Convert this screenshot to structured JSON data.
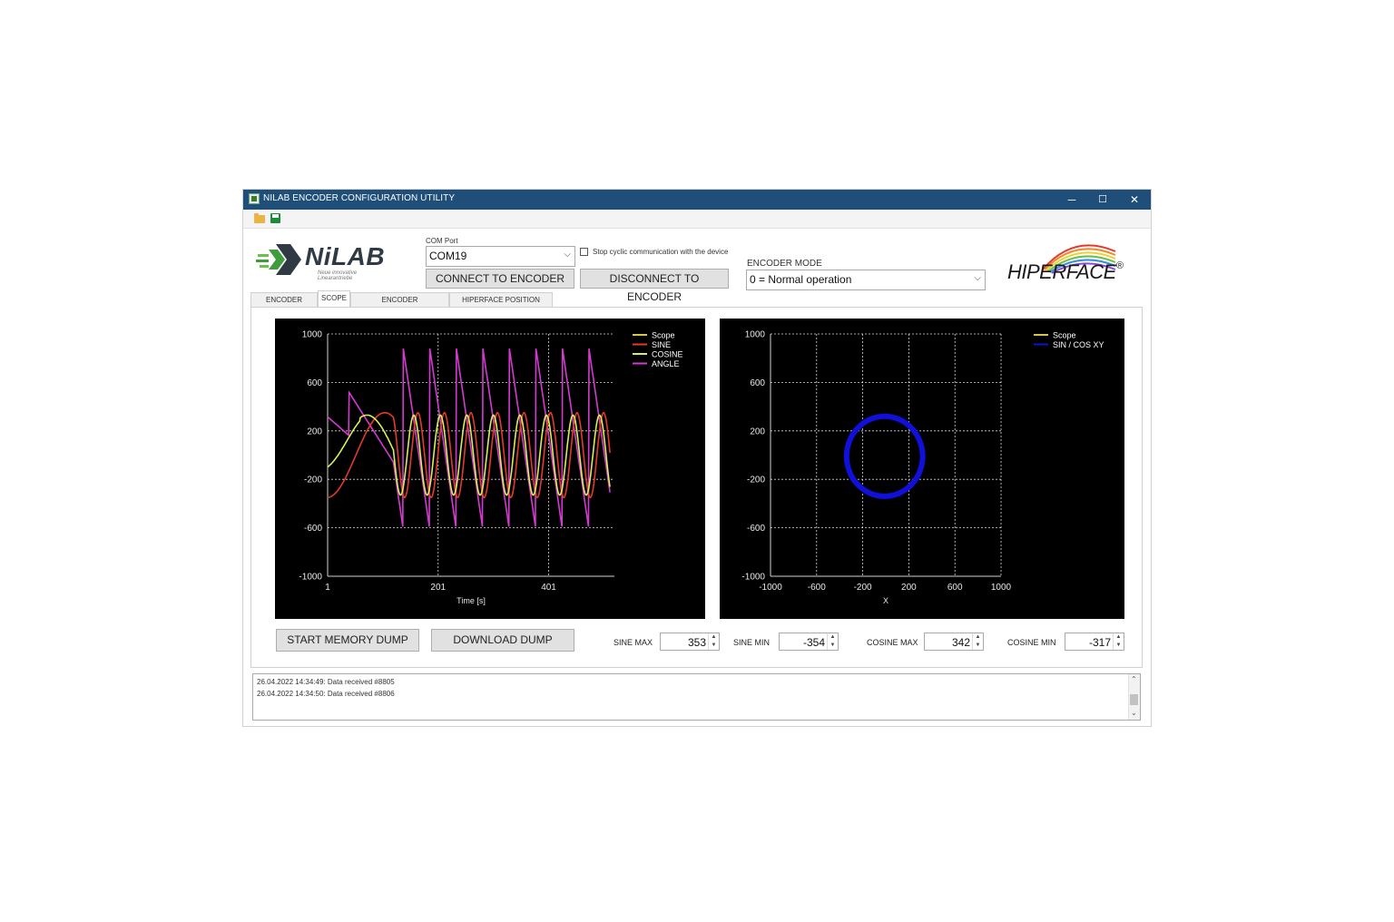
{
  "window": {
    "title": "NILAB ENCODER CONFIGURATION UTILITY",
    "minimize": "─",
    "maximize": "☐",
    "close": "✕"
  },
  "logo": {
    "brand": "NiLAB",
    "tagline": "Neue innovative Linearantriebe"
  },
  "com": {
    "label": "COM Port",
    "value": "COM19",
    "stop_label": "Stop cyclic communication with the device"
  },
  "buttons": {
    "connect": "CONNECT TO ENCODER",
    "disconnect": "DISCONNECT TO ENCODER",
    "start_dump": "START MEMORY DUMP",
    "download_dump": "DOWNLOAD DUMP"
  },
  "encoder_mode": {
    "label": "ENCODER MODE",
    "value": "0 = Normal operation"
  },
  "hiperface": {
    "text": "HIPERFACE",
    "mark": "®"
  },
  "tabs": [
    {
      "label": "ENCODER STATUS"
    },
    {
      "label": "SCOPE"
    },
    {
      "label": "ENCODER CONFIGURATION"
    },
    {
      "label": "HIPERFACE POSITION DEBUG"
    }
  ],
  "stats": {
    "sine_max": {
      "label": "SINE MAX",
      "value": "353"
    },
    "sine_min": {
      "label": "SINE MIN",
      "value": "-354"
    },
    "cosine_max": {
      "label": "COSINE MAX",
      "value": "342"
    },
    "cosine_min": {
      "label": "COSINE MIN",
      "value": "-317"
    }
  },
  "log": [
    "26.04.2022 14:34:49: Data received #8805",
    "26.04.2022 14:34:50: Data received #8806"
  ],
  "colors": {
    "title_bar": "#1f4e79",
    "scope": "#d4c84a",
    "sine": "#e23a2e",
    "cosine": "#d8ef5a",
    "angle": "#d43ad0",
    "sincos": "#1010d8"
  },
  "chart_data": [
    {
      "type": "line",
      "xlabel": "Time [s]",
      "ylabel": "",
      "xlim": [
        1,
        520
      ],
      "ylim": [
        -1000,
        1000
      ],
      "x_ticks": [
        "1",
        "201",
        "401"
      ],
      "y_ticks": [
        "1000",
        "600",
        "200",
        "-200",
        "-600",
        "-1000"
      ],
      "grid": true,
      "legend": "top-right",
      "series": [
        {
          "name": "Scope",
          "values": []
        },
        {
          "name": "SINE",
          "amplitude": 350,
          "period_approx": 48
        },
        {
          "name": "COSINE",
          "amplitude": 330,
          "period_approx": 48
        },
        {
          "name": "ANGLE",
          "range": [
            -600,
            900
          ],
          "period_approx": 48
        }
      ]
    },
    {
      "type": "scatter",
      "xlabel": "X",
      "ylabel": "",
      "xlim": [
        -1000,
        1000
      ],
      "ylim": [
        -1000,
        1000
      ],
      "x_ticks": [
        "-1000",
        "-600",
        "-200",
        "200",
        "600",
        "1000"
      ],
      "y_ticks": [
        "1000",
        "600",
        "200",
        "-200",
        "-600",
        "-1000"
      ],
      "grid": true,
      "legend": "top-right",
      "series": [
        {
          "name": "Scope",
          "values": []
        },
        {
          "name": "SIN / COS XY",
          "center": [
            -10,
            -10
          ],
          "radius": 330
        }
      ]
    }
  ]
}
